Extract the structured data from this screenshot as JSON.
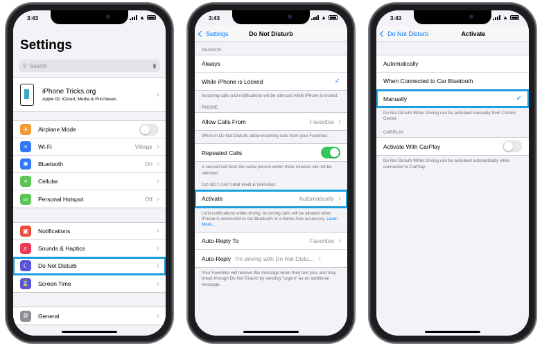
{
  "status_time": "3:43",
  "colors": {
    "accent": "#007aff",
    "highlight": "#1a9ee0",
    "toggle_on": "#34c759"
  },
  "settings": {
    "title": "Settings",
    "search_placeholder": "Search",
    "profile": {
      "name": "iPhone Tricks.org",
      "subtitle": "Apple ID, iCloud, Media & Purchases"
    },
    "rows": [
      {
        "label": "Airplane Mode",
        "icon": "airplane-icon",
        "color": "#f19a37",
        "type": "toggle"
      },
      {
        "label": "Wi-Fi",
        "icon": "wifi-icon",
        "color": "#3478f6",
        "value": "Village"
      },
      {
        "label": "Bluetooth",
        "icon": "bluetooth-icon",
        "color": "#3478f6",
        "value": "On"
      },
      {
        "label": "Cellular",
        "icon": "cellular-icon",
        "color": "#5fc456",
        "value": ""
      },
      {
        "label": "Personal Hotspot",
        "icon": "hotspot-icon",
        "color": "#5fc456",
        "value": "Off"
      }
    ],
    "rows2": [
      {
        "label": "Notifications",
        "icon": "notifications-icon",
        "color": "#ec4a3c"
      },
      {
        "label": "Sounds & Haptics",
        "icon": "sound-icon",
        "color": "#ec3b58"
      },
      {
        "label": "Do Not Disturb",
        "icon": "moon-icon",
        "color": "#5a55d6"
      },
      {
        "label": "Screen Time",
        "icon": "hourglass-icon",
        "color": "#5a55d6"
      }
    ],
    "rows3": [
      {
        "label": "General",
        "icon": "gear-icon",
        "color": "#8e8e93"
      }
    ]
  },
  "dnd": {
    "back": "Settings",
    "title": "Do Not Disturb",
    "silence_header": "SILENCE:",
    "always": "Always",
    "while_locked": "While iPhone is Locked",
    "silence_footer": "Incoming calls and notifications will be silenced while iPhone is locked.",
    "phone_header": "PHONE",
    "allow_calls": "Allow Calls From",
    "allow_calls_value": "Favorites",
    "allow_footer": "When in Do Not Disturb, allow incoming calls from your Favorites.",
    "repeated": "Repeated Calls",
    "repeated_footer": "A second call from the same person within three minutes will not be silenced.",
    "driving_header": "DO NOT DISTURB WHILE DRIVING",
    "activate": "Activate",
    "activate_value": "Automatically",
    "activate_footer": "Limit notifications while driving. Incoming calls will be allowed when iPhone is connected to car Bluetooth or a hands-free accessory.",
    "learn_more": "Learn More...",
    "auto_reply_to": "Auto-Reply To",
    "auto_reply_to_value": "Favorites",
    "auto_reply": "Auto-Reply",
    "auto_reply_value": "I'm driving with Do Not Distu...",
    "auto_reply_footer": "Your Favorites will receive this message when they text you, and may break through Do Not Disturb by sending \"urgent\" as an additional message."
  },
  "activate": {
    "back": "Do Not Disturb",
    "title": "Activate",
    "automatically": "Automatically",
    "car_bluetooth": "When Connected to Car Bluetooth",
    "manually": "Manually",
    "manually_footer": "Do Not Disturb While Driving can be activated manually from Control Center.",
    "carplay_header": "CARPLAY",
    "carplay": "Activate With CarPlay",
    "carplay_footer": "Do Not Disturb While Driving can be activated automatically while connected to CarPlay."
  }
}
